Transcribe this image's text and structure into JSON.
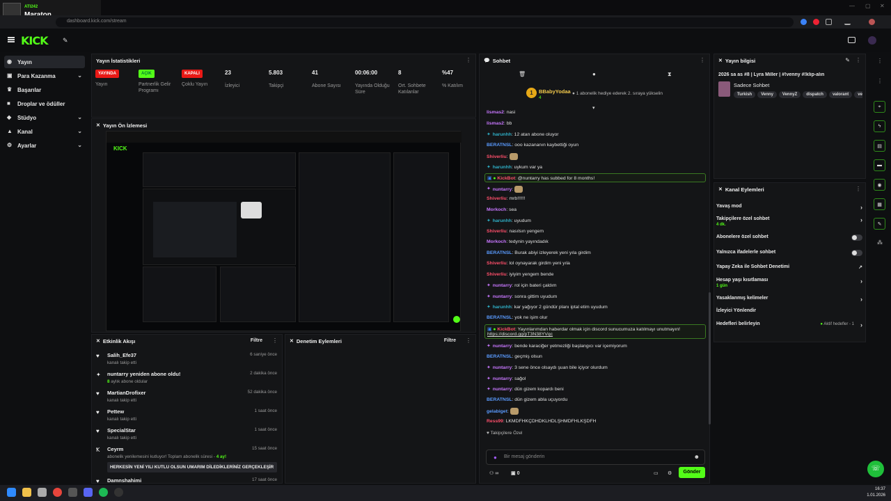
{
  "colors": {
    "accent": "#53fc18",
    "live": "#e91916",
    "chat_mint": "#2fb0c8"
  },
  "browser": {
    "url": "dashboard.kick.com/stream",
    "now_playing_artist": "ATI242",
    "now_playing_title": "Maraton"
  },
  "sidebar": {
    "items": [
      {
        "label": "Yayın",
        "icon": "broadcast-icon",
        "active": true,
        "chevron": false
      },
      {
        "label": "Para Kazanma",
        "icon": "money-icon",
        "chevron": true
      },
      {
        "label": "Başarılar",
        "icon": "trophy-icon",
        "chevron": false
      },
      {
        "label": "Droplar ve ödüller",
        "icon": "gift-icon",
        "chevron": false
      },
      {
        "label": "Stüdyo",
        "icon": "studio-icon",
        "chevron": true
      },
      {
        "label": "Kanal",
        "icon": "channel-icon",
        "chevron": true
      },
      {
        "label": "Ayarlar",
        "icon": "gear-icon",
        "chevron": true
      }
    ]
  },
  "stats": {
    "title": "Yayın İstatistikleri",
    "items": [
      {
        "value": "YAYINDA",
        "label": "Yayın",
        "kind": "red"
      },
      {
        "value": "AÇIK",
        "label": "Partnerlik Gelir Programı",
        "kind": "green"
      },
      {
        "value": "KAPALI",
        "label": "Çoklu Yayın",
        "kind": "red"
      },
      {
        "value": "23",
        "label": "İzleyici"
      },
      {
        "value": "5.803",
        "label": "Takipçi"
      },
      {
        "value": "41",
        "label": "Abone Sayısı"
      },
      {
        "value": "00:06:00",
        "label": "Yayında Olduğu Süre"
      },
      {
        "value": "8",
        "label": "Ort. Sohbete Katılanlar"
      },
      {
        "value": "%47",
        "label": "% Katılım"
      }
    ]
  },
  "preview": {
    "title": "Yayın Ön İzlemesi"
  },
  "activity": {
    "title": "Etkinlik Akışı",
    "filter": "Filtre",
    "items": [
      {
        "icon": "heart-icon",
        "name": "Salih_Efe37",
        "sub": "kanalı takip etti",
        "time": "6 saniye önce"
      },
      {
        "icon": "star-icon",
        "name": "nuntarry yeniden abone oldu!",
        "sub": "aylık abone oldular",
        "sub_hl": "8",
        "time": "2 dakika önce"
      },
      {
        "icon": "heart-icon",
        "name": "MartianDrofixer",
        "sub": "kanalı takip etti",
        "time": "52 dakika önce"
      },
      {
        "icon": "heart-icon",
        "name": "Pettew",
        "sub": "kanalı takip etti",
        "time": "1 saat önce"
      },
      {
        "icon": "heart-icon",
        "name": "SpecialStar",
        "sub": "kanalı takip etti",
        "time": "1 saat önce"
      },
      {
        "icon": "kick-icon",
        "name": "Ceyrm",
        "sub": "abonelik yenilemesini kutluyor! Toplam abonelik süresi -",
        "sub_hl": "4 ay!",
        "time": "15 saat önce",
        "message": "HERKESİN YENİ YILI KUTLU OLSUN UMARIM DİLEDİKLERİNİZ GERÇEKLEŞİR"
      },
      {
        "icon": "heart-icon",
        "name": "Damnshahimi",
        "sub": "",
        "time": "17 saat önce"
      }
    ]
  },
  "moderation": {
    "title": "Denetim Eylemleri",
    "filter": "Filtre"
  },
  "chat": {
    "title": "Sohbet",
    "gifter": {
      "name": "BBabyYodaa",
      "count": "4",
      "text": "1 abonelik hediye ederek 2. sıraya yükselin",
      "rank": "1"
    },
    "lines": [
      {
        "user": "lismas2",
        "color": "#c877ff",
        "text": "nasi"
      },
      {
        "user": "lismas2",
        "color": "#c877ff",
        "text": "bb"
      },
      {
        "user": "harunhh",
        "color": "#2fb0c8",
        "text": "12 atan abone oluyor",
        "badge": true
      },
      {
        "user": "BERATNSL",
        "color": "#5a9bff",
        "text": "ooo kazananın kaybettiği oyun"
      },
      {
        "user": "Shiverliu",
        "color": "#ff4f6b",
        "text": "",
        "emote": true
      },
      {
        "user": "harunhh",
        "color": "#2fb0c8",
        "text": "uykum var ya",
        "badge": true
      },
      {
        "system": true,
        "user": "KickBot",
        "color": "#ff4f6b",
        "text": "@nuntarry has subbed for 8 months!"
      },
      {
        "user": "nuntarry",
        "color": "#c877ff",
        "text": "",
        "emote": true,
        "badge": true
      },
      {
        "user": "Shiverliu",
        "color": "#ff4f6b",
        "text": "mrb!!!!!!"
      },
      {
        "user": "Morkoch",
        "color": "#c877ff",
        "text": "sea"
      },
      {
        "user": "harunhh",
        "color": "#2fb0c8",
        "text": "uyudum",
        "badge": true
      },
      {
        "user": "Shiverliu",
        "color": "#ff4f6b",
        "text": "nasılsın yengem"
      },
      {
        "user": "Morkoch",
        "color": "#c877ff",
        "text": "tedynin yayındadık"
      },
      {
        "user": "BERATNSL",
        "color": "#5a9bff",
        "text": "Burak abiyi izleyerek yeni yıla girdim"
      },
      {
        "user": "Shiverliu",
        "color": "#ff4f6b",
        "text": "lol oynayarak girdim yeni yıla"
      },
      {
        "user": "Shiverliu",
        "color": "#ff4f6b",
        "text": "iyiyim yengem bende"
      },
      {
        "user": "nuntarry",
        "color": "#c877ff",
        "text": "rol için bateri çaldım",
        "badge": true
      },
      {
        "user": "nuntarry",
        "color": "#c877ff",
        "text": "sonra gittim uyudum",
        "badge": true
      },
      {
        "user": "harunhh",
        "color": "#2fb0c8",
        "text": "kar yağıyor 2 gündür planı iptal etim uyudum",
        "badge": true
      },
      {
        "user": "BERATNSL",
        "color": "#5a9bff",
        "text": "yok ne işim olur"
      },
      {
        "system": true,
        "user": "KickBot",
        "color": "#ff4f6b",
        "text": "Yayınlarımdan haberdar olmak için discord sunucumuza katılmayı unutmayın!",
        "link": "https://discord.gg/pT3N38YVqc"
      },
      {
        "user": "nuntarry",
        "color": "#c877ff",
        "text": "bende karaciğer yetmezliği başlangıcı var içemiyorum",
        "badge": true
      },
      {
        "user": "BERATNSL",
        "color": "#5a9bff",
        "text": "geçmiş olsun"
      },
      {
        "user": "nuntarry",
        "color": "#c877ff",
        "text": "3 sene önce olsaydı şuan bile içiyor olurdum",
        "badge": true
      },
      {
        "user": "nuntarry",
        "color": "#c877ff",
        "text": "sağol",
        "badge": true
      },
      {
        "user": "nuntarry",
        "color": "#c877ff",
        "text": "dün gizem kopardı beni",
        "badge": true
      },
      {
        "user": "BERATNSL",
        "color": "#5a9bff",
        "text": "dün gizem abla uçuyordu"
      },
      {
        "user": "gelabiget",
        "color": "#5a9bff",
        "text": "",
        "emote": true
      },
      {
        "user": "Ress99",
        "color": "#ff4f6b",
        "text": "LKMDFHKÇDHDKLHDLŞHMDFHLKŞDFH"
      }
    ],
    "emote_section": "Takipçilere Özel",
    "input_placeholder": "Bir mesaj gönderin",
    "points": "0",
    "send": "Gönder"
  },
  "stream_info": {
    "title_label": "Yayın bilgisi",
    "stream_title": "2026 sa as #8 | Lyra Miller | #!venny #!klip-alın",
    "category": "Sadece Sohbet",
    "tags": [
      "Turkish",
      "Venny",
      "VennyZ",
      "dispatch",
      "valorant",
      "ven"
    ]
  },
  "channel_actions": {
    "title": "Kanal Eylemleri",
    "items": [
      {
        "label": "Yavaş mod",
        "type": "arrow"
      },
      {
        "label": "Takipçilere özel sohbet",
        "sub": "4 dk.",
        "type": "arrow"
      },
      {
        "label": "Abonelere özel sohbet",
        "type": "toggle"
      },
      {
        "label": "Yalnızca ifadelerle sohbet",
        "type": "toggle"
      },
      {
        "label": "Yapay Zeka ile Sohbet Denetimi",
        "type": "ext"
      },
      {
        "label": "Hesap yaşı kısıtlaması",
        "sub": "1 gün",
        "type": "arrow"
      },
      {
        "label": "Yasaklanmış kelimeler",
        "type": "arrow"
      },
      {
        "label": "İzleyici Yönlendir",
        "type": "none"
      },
      {
        "label": "Hedefleri belirleyin",
        "extra": "Aktif hedefler - 1",
        "type": "arrow"
      }
    ]
  },
  "taskbar": {
    "time": "16:37",
    "date": "1.01.2026"
  }
}
